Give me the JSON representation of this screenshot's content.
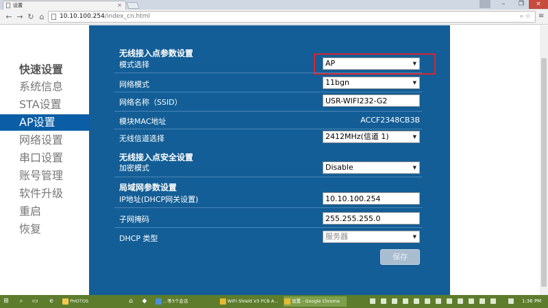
{
  "browser": {
    "tab_title": "设置",
    "tab_close": "×",
    "url_host": "10.10.100.254",
    "url_path": "/index_cn.html",
    "window_min": "–",
    "window_max": "❐",
    "window_close": "×",
    "menu_icon": "≡"
  },
  "sidebar": {
    "items": [
      {
        "label": "快速设置"
      },
      {
        "label": "系统信息"
      },
      {
        "label": "STA设置"
      },
      {
        "label": "AP设置"
      },
      {
        "label": "网络设置"
      },
      {
        "label": "串口设置"
      },
      {
        "label": "账号管理"
      },
      {
        "label": "软件升级"
      },
      {
        "label": "重启"
      },
      {
        "label": "恢复"
      }
    ],
    "active_index": 3
  },
  "panel": {
    "ap_section_title": "无线接入点参数设置",
    "mode_label": "模式选择",
    "mode_value": "AP",
    "net_mode_label": "网络模式",
    "net_mode_value": "11bgn",
    "ssid_label": "网络名称（SSID）",
    "ssid_value": "USR-WIFI232-G2",
    "mac_label": "模块MAC地址",
    "mac_value": "ACCF2348CB3B",
    "channel_label": "无线信道选择",
    "channel_value": "2412MHz(信道 1)",
    "security_section_title": "无线接入点安全设置",
    "encrypt_label": "加密模式",
    "encrypt_value": "Disable",
    "lan_section_title": "局域网参数设置",
    "ip_label": "IP地址(DHCP网关设置)",
    "ip_value": "10.10.100.254",
    "mask_label": "子网掩码",
    "mask_value": "255.255.255.0",
    "dhcp_label": "DHCP 类型",
    "dhcp_value": "服务器",
    "save_label": "保存"
  },
  "taskbar": {
    "items": [
      {
        "label": "PHOTOS"
      },
      {
        "label": "...等3个会话"
      },
      {
        "label": "WIFI Shield V3 PCB A..."
      },
      {
        "label": "设置 - Google Chrome"
      }
    ],
    "clock": "1:36 PM"
  },
  "colors": {
    "panel_bg": "#135e96",
    "active_sidebar": "#0b5ea6",
    "highlight_border": "#d9242f",
    "taskbar_bg": "#5d7d2c"
  }
}
